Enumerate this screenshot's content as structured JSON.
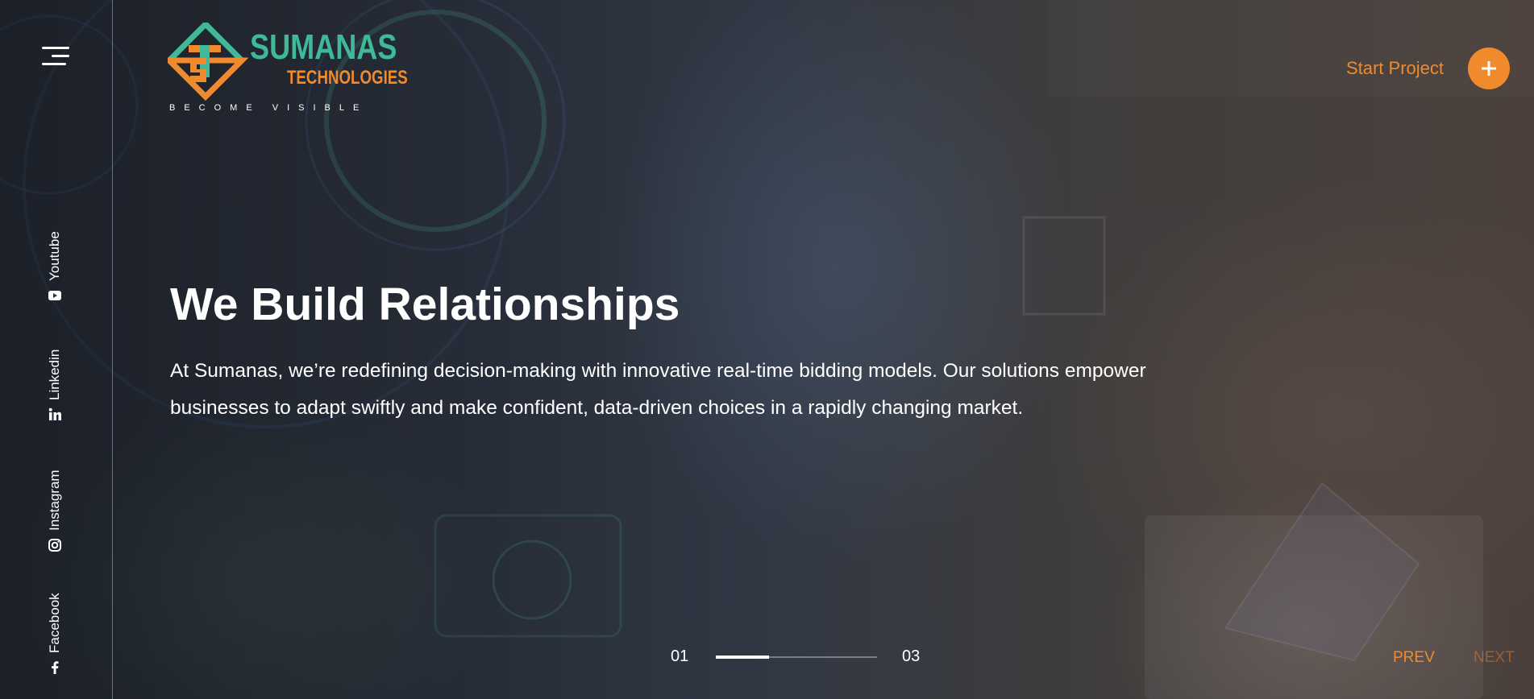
{
  "brand": {
    "name": "SUMANAS",
    "sub": "TECHNOLOGIES",
    "tagline": "BECOME VISIBLE",
    "accent": "#f08a2c",
    "green": "#3fb99a"
  },
  "header": {
    "start_project_label": "Start Project",
    "plus_icon": "plus-icon",
    "menu_icon": "hamburger-menu-icon"
  },
  "social": [
    {
      "label": "Youtube",
      "icon": "youtube-icon"
    },
    {
      "label": "Linkedin",
      "icon": "linkedin-icon"
    },
    {
      "label": "Instagram",
      "icon": "instagram-icon"
    },
    {
      "label": "Facebook",
      "icon": "facebook-icon"
    }
  ],
  "hero": {
    "headline": "We Build Relationships",
    "paragraph": "At Sumanas, we’re redefining decision-making with innovative real-time bidding models. Our solutions empower businesses to adapt swiftly and make confident, data-driven choices in a rapidly changing market."
  },
  "slider": {
    "current": "01",
    "total": "03",
    "progress": 0.33,
    "prev_label": "PREV",
    "next_label": "NEXT"
  }
}
